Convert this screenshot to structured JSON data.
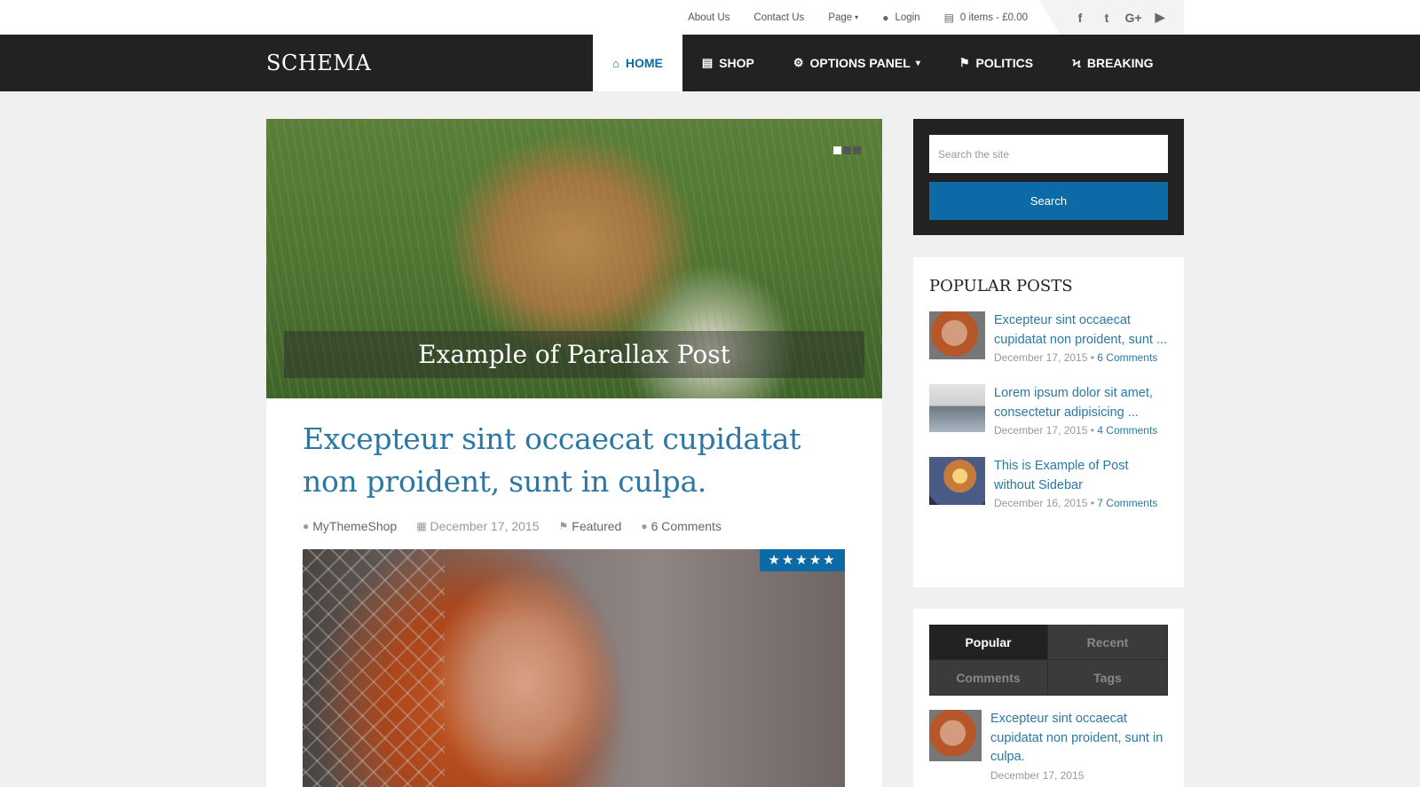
{
  "topbar": {
    "links": [
      {
        "label": "About Us"
      },
      {
        "label": "Contact Us"
      },
      {
        "label": "Page",
        "caret": "▾"
      }
    ],
    "login": {
      "label": "Login",
      "icon": "user-icon"
    },
    "cart": {
      "label": "0 items - £0.00",
      "icon": "cart-icon"
    },
    "social": [
      {
        "name": "facebook-icon",
        "glyph": "f"
      },
      {
        "name": "twitter-icon",
        "glyph": "t"
      },
      {
        "name": "google-plus-icon",
        "glyph": "G+"
      },
      {
        "name": "youtube-icon",
        "glyph": "▶"
      }
    ]
  },
  "site": {
    "logo": "SCHEMA"
  },
  "nav": {
    "items": [
      {
        "label": "Home",
        "icon": "home-icon",
        "glyph": "⌂",
        "active": true
      },
      {
        "label": "Shop",
        "icon": "cart-icon",
        "glyph": "🛒"
      },
      {
        "label": "Options Panel",
        "icon": "cogs-icon",
        "glyph": "⚙",
        "caret": "▾"
      },
      {
        "label": "Politics",
        "icon": "flag-icon",
        "glyph": "⚑"
      },
      {
        "label": "Breaking",
        "icon": "bolt-icon",
        "glyph": "ϟ"
      }
    ],
    "accent": "#0c6aa6"
  },
  "slider": {
    "caption": "Example of Parallax Post",
    "dots": 3,
    "active_dot": 1
  },
  "post": {
    "title": "Excepteur sint occaecat cupidatat non proident, sunt in culpa.",
    "author": "MyThemeShop",
    "date": "December 17, 2015",
    "category": "Featured",
    "comments": "6 Comments",
    "rating_stars": 5,
    "rating_text": "★★★★★"
  },
  "search": {
    "placeholder": "Search the site",
    "button": "Search"
  },
  "popular_posts": {
    "title": "Popular Posts",
    "items": [
      {
        "title": "Excepteur sint occaecat cupidatat non proident, sunt ...",
        "date": "December 17, 2015",
        "sep": " • ",
        "comments": "6 Comments"
      },
      {
        "title": "Lorem ipsum dolor sit amet, consectetur adipisicing ...",
        "date": "December 17, 2015",
        "sep": " • ",
        "comments": "4 Comments"
      },
      {
        "title": "This is Example of Post without Sidebar",
        "date": "December 16, 2015",
        "sep": " • ",
        "comments": "7 Comments"
      }
    ]
  },
  "tabs_widget": {
    "tabs": [
      "Popular",
      "Recent",
      "Comments",
      "Tags"
    ],
    "active": "Popular",
    "post": {
      "title": "Excepteur sint occaecat cupidatat non proident, sunt in culpa.",
      "date": "December 17, 2015"
    }
  },
  "colors": {
    "link": "#2c78a4",
    "dark": "#222222",
    "accent": "#0c6aa6"
  }
}
